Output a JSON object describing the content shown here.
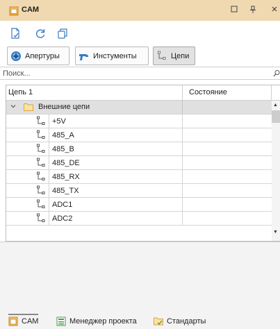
{
  "window": {
    "title": "CAM",
    "maximize_icon": "square-icon",
    "pin_icon": "pin-icon",
    "close_icon": "close-icon"
  },
  "toolbar": {
    "items": [
      {
        "name": "new-file-button",
        "icon": "file-add-icon"
      },
      {
        "name": "refresh-button",
        "icon": "refresh-icon"
      },
      {
        "name": "copy-button",
        "icon": "copy-icon"
      }
    ]
  },
  "modes": {
    "apertures_label": "Апертуры",
    "tools_label": "Инстументы",
    "nets_label": "Цепи",
    "active": "nets"
  },
  "search": {
    "placeholder": "Поиск..."
  },
  "grid": {
    "col_net": "Цепь 1",
    "col_state": "Состояние",
    "group_label": "Внешние цепи",
    "nets": [
      "+5V",
      "485_A",
      "485_B",
      "485_DE",
      "485_RX",
      "485_TX",
      "ADC1",
      "ADC2"
    ]
  },
  "tabs": {
    "cam_label": "CAM",
    "project_manager_label": "Менеджер проекта",
    "standards_label": "Стандарты",
    "active": "cam"
  },
  "colors": {
    "title_bar": "#f0d9b0",
    "group_row": "#e0e0e0",
    "accent_orange": "#e89a23",
    "icon_blue": "#3a7bbf",
    "icon_green": "#4a9a4a"
  }
}
